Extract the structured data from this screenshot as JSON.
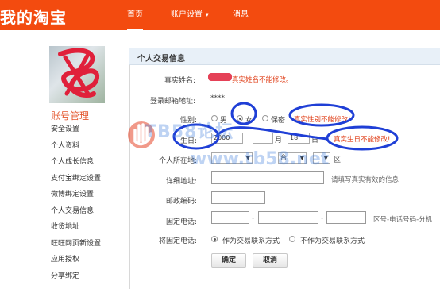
{
  "header": {
    "logo_text": "我的淘宝",
    "nav": [
      "首页",
      "账户设置",
      "消息"
    ]
  },
  "sidebar": {
    "title": "账号管理",
    "items": [
      "安全设置",
      "个人资料",
      "个人成长信息",
      "支付宝绑定设置",
      "微博绑定设置",
      "个人交易信息",
      "收货地址",
      "旺旺网页新设置",
      "应用授权",
      "分享绑定"
    ]
  },
  "main": {
    "title": "个人交易信息",
    "realname_label": "真实姓名:",
    "realname_warn": "真实姓名不能修改。",
    "email_label": "登录邮箱地址:",
    "email_value": "****",
    "gender_label": "性别:",
    "gender_options": [
      "男",
      "女",
      "保密"
    ],
    "gender_warn": "真实性别不能修改!",
    "birthday_label": "生日:",
    "birthday_year": "2000",
    "birthday_month": "月",
    "birthday_day": "18",
    "birthday_day_unit": "日",
    "birthday_warn": "真实生日不能修改!",
    "location_label": "个人所在地:",
    "location_city": "台",
    "location_district_unit": "区",
    "address_label": "详细地址:",
    "address_hint": "请填写真实有效的信息",
    "postcode_label": "邮政编码:",
    "phone_label": "固定电话:",
    "phone_dash": "-",
    "phone_hint": "区号-电话号码-分机",
    "fixedphone_label": "将固定电话:",
    "contact_options": [
      "作为交易联系方式",
      "不作为交易联系方式"
    ],
    "confirm_button": "确定",
    "cancel_button": "取消"
  },
  "watermark": {
    "text1": "TB58论坛",
    "text2": "www.tb58.net"
  },
  "colors": {
    "header_bg": "#f34b0f",
    "warn": "#e0401a",
    "annotation": "#1f3fd6"
  }
}
